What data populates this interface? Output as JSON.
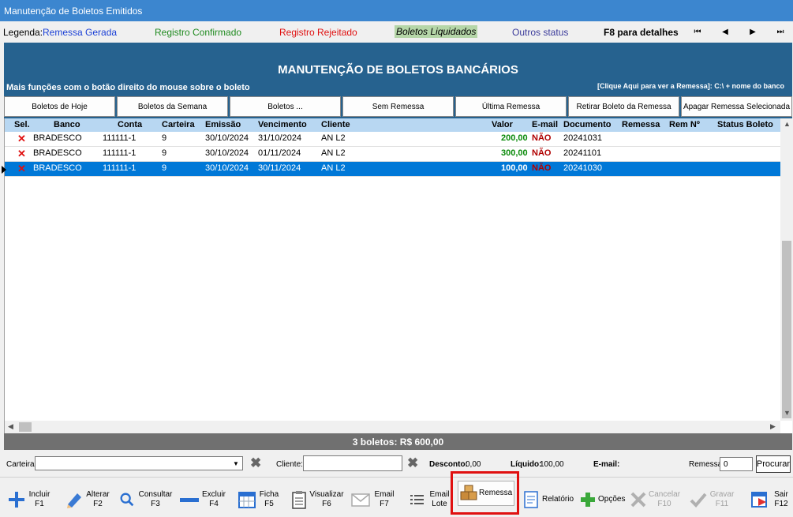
{
  "window": {
    "title": "Manutenção de Boletos Emitidos"
  },
  "legend": {
    "label": "Legenda:",
    "items": [
      {
        "label": "Remessa Gerada",
        "color": "#1a3fd6"
      },
      {
        "label": "Registro Confirmado",
        "color": "#1f8a1f"
      },
      {
        "label": "Registro Rejeitado",
        "color": "#e01010"
      },
      {
        "label": "Boletos Liquidados",
        "color": "#1a1a1a",
        "background": "#b5d6a8"
      },
      {
        "label": "Outros status",
        "color": "#3a3a9a"
      }
    ],
    "f8_hint": "F8 para detalhes",
    "nav": {
      "first": "⏮",
      "prev": "◀",
      "next": "▶",
      "last": "⏭"
    }
  },
  "banner": {
    "title": "MANUTENÇÃO DE BOLETOS BANCÁRIOS",
    "hint_left": "Mais funções com o botão direito do mouse sobre o boleto",
    "hint_right": "[Clique Aqui para ver a Remessa]: C:\\ + nome do banco"
  },
  "filters": {
    "buttons": [
      "Boletos de Hoje",
      "Boletos da Semana",
      "Boletos ...",
      "Sem Remessa",
      "Última Remessa",
      "Retirar Boleto da Remessa",
      "Apagar Remessa Selecionada"
    ]
  },
  "table": {
    "columns": [
      "Sel.",
      "Banco",
      "Conta",
      "Carteira",
      "Emissão",
      "Vencimento",
      "Cliente",
      "Valor",
      "E-mail",
      "Documento",
      "Remessa",
      "Rem Nº",
      "Status Boleto"
    ],
    "rows": [
      {
        "sel": "✕",
        "banco": "BRADESCO",
        "conta": "111111-1",
        "carteira": "9",
        "emissao": "30/10/2024",
        "vencimento": "31/10/2024",
        "cliente": "AN L2",
        "valor": "200,00",
        "email": "NÃO",
        "documento": "20241031",
        "remessa": "",
        "rem_n": "",
        "status": ""
      },
      {
        "sel": "✕",
        "banco": "BRADESCO",
        "conta": "111111-1",
        "carteira": "9",
        "emissao": "30/10/2024",
        "vencimento": "01/11/2024",
        "cliente": "AN L2",
        "valor": "300,00",
        "email": "NÃO",
        "documento": "20241101",
        "remessa": "",
        "rem_n": "",
        "status": ""
      },
      {
        "sel": "✕",
        "banco": "BRADESCO",
        "conta": "111111-1",
        "carteira": "9",
        "emissao": "30/10/2024",
        "vencimento": "30/11/2024",
        "cliente": "AN L2",
        "valor": "100,00",
        "email": "NÃO",
        "documento": "20241030",
        "remessa": "",
        "rem_n": "",
        "status": "",
        "selected": true
      }
    ]
  },
  "totals": {
    "summary": "3 boletos: R$ 600,00"
  },
  "search": {
    "carteira_label": "Carteira",
    "carteira_value": "",
    "cliente_label": "Cliente:",
    "cliente_value": "",
    "desconto_label": "Desconto:",
    "desconto_value": "0,00",
    "liquido_label": "Líquido:",
    "liquido_value": "100,00",
    "email_label": "E-mail:",
    "remessa_label": "Remessa",
    "remessa_value": "0",
    "procurar_label": "Procurar"
  },
  "toolbar": {
    "incluir": "Incluir F1",
    "alterar": "Alterar F2",
    "consultar": "Consultar F3",
    "excluir": "Excluir F4",
    "ficha": "Ficha F5",
    "visualizar": "Visualizar F6",
    "email": "Email F7",
    "email_lote": "Email Lote",
    "remessa": "Remessa",
    "relatorio": "Relatório",
    "opcoes": "Opções",
    "cancelar": "Cancelar F10",
    "gravar": "Gravar F11",
    "sair": "Sair F12"
  }
}
